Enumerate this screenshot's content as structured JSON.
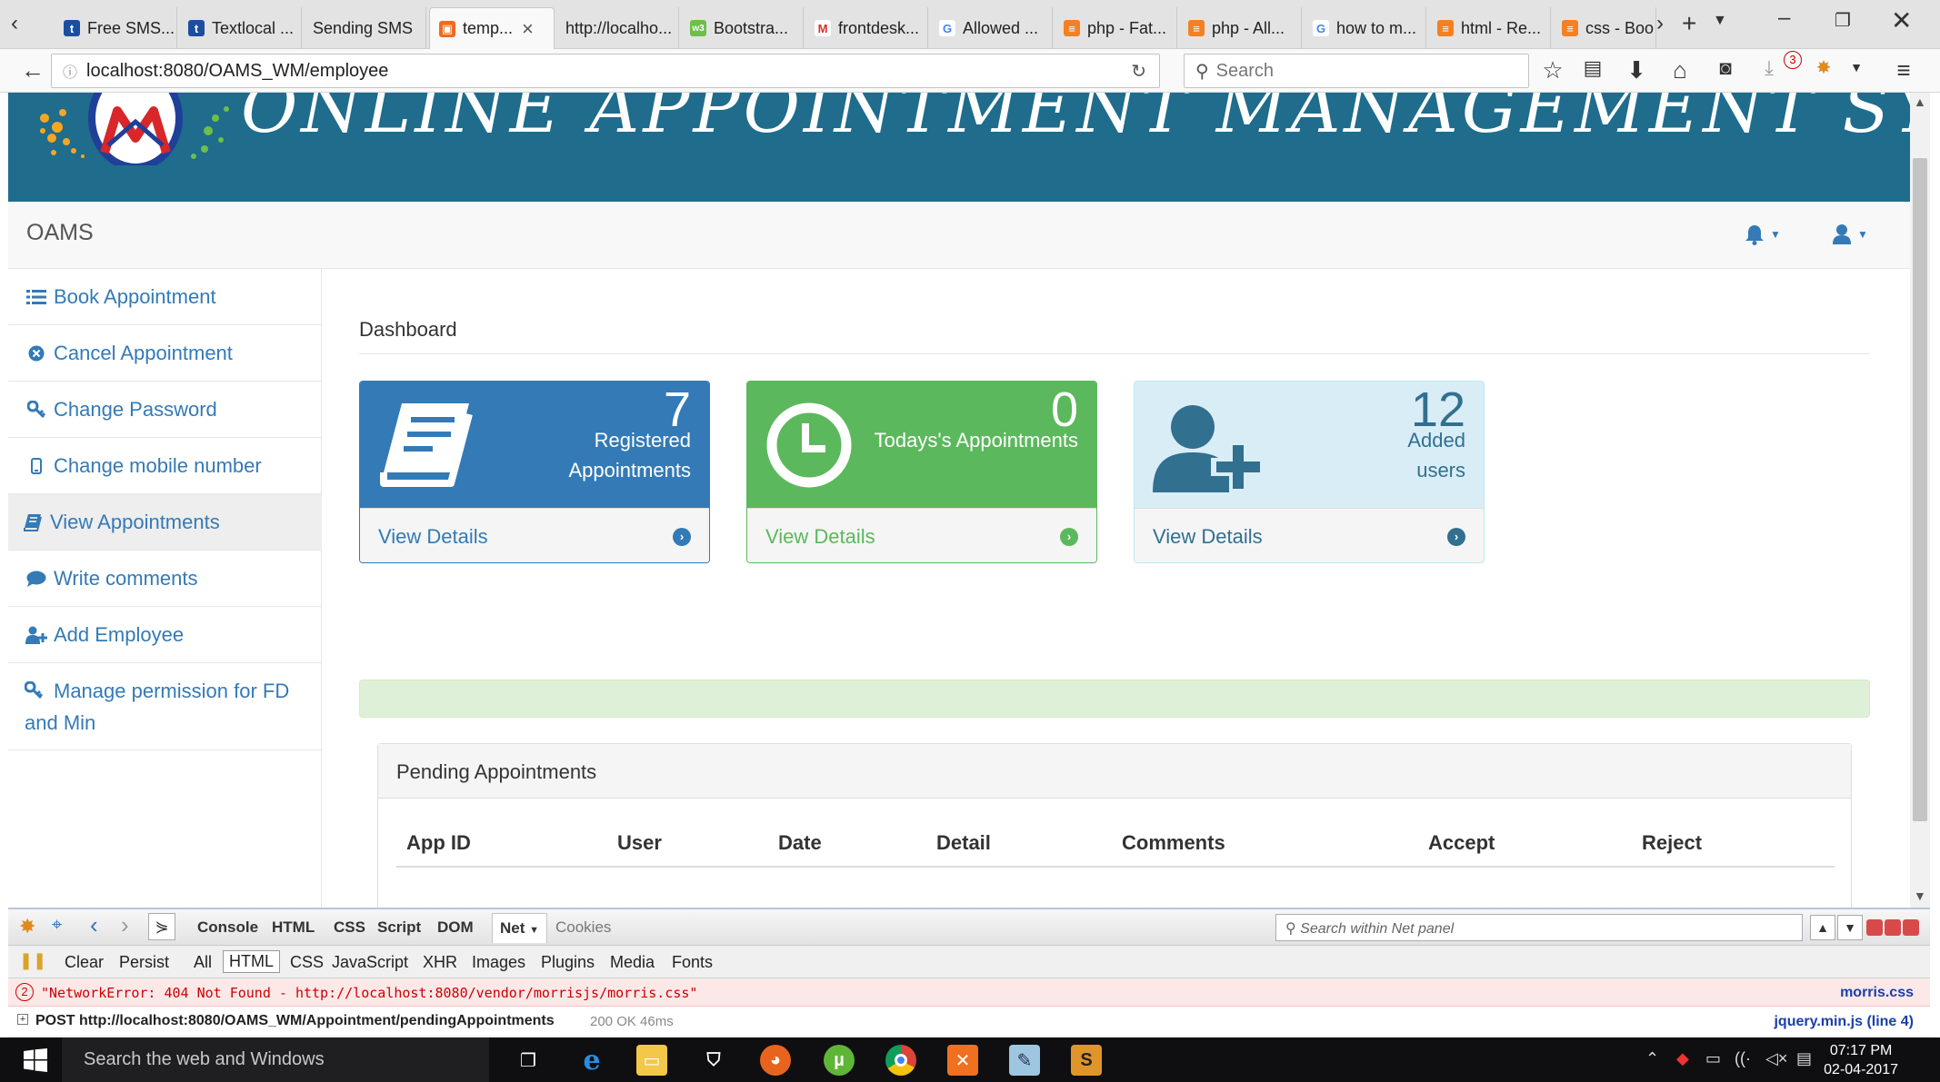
{
  "browser": {
    "tabs": [
      {
        "label": "Free SMS..."
      },
      {
        "label": "Textlocal ..."
      },
      {
        "label": "Sending SMS"
      },
      {
        "label": "temp..."
      },
      {
        "label": "http://localho..."
      },
      {
        "label": "Bootstra..."
      },
      {
        "label": "frontdesk..."
      },
      {
        "label": "Allowed ..."
      },
      {
        "label": "php - Fat..."
      },
      {
        "label": "php - All..."
      },
      {
        "label": "how to m..."
      },
      {
        "label": "html - Re..."
      },
      {
        "label": "css - Boo"
      }
    ],
    "url": "localhost:8080/OAMS_WM/employee",
    "search_placeholder": "Search",
    "download_badge": "3"
  },
  "page": {
    "banner_title": "ONLINE APPOINTMENT MANAGEMENT SYSTEM",
    "brand": "OAMS",
    "sidebar": [
      {
        "label": "Book Appointment",
        "icon": "list-icon"
      },
      {
        "label": "Cancel Appointment",
        "icon": "times-circle-icon"
      },
      {
        "label": "Change Password",
        "icon": "key-icon"
      },
      {
        "label": "Change mobile number",
        "icon": "mobile-icon"
      },
      {
        "label": "View Appointments",
        "icon": "book-icon"
      },
      {
        "label": "Write comments",
        "icon": "comment-icon"
      },
      {
        "label": "Add Employee",
        "icon": "user-plus-icon"
      },
      {
        "label": "Manage permission for FD and Min",
        "icon": "key-icon"
      }
    ],
    "dashboard_title": "Dashboard",
    "panels": [
      {
        "count": "7",
        "label": "Registered Appointments",
        "footer": "View Details",
        "color": "#337ab7"
      },
      {
        "count": "0",
        "label": "Todays's Appointments",
        "footer": "View Details",
        "color": "#5cb85c"
      },
      {
        "count": "12",
        "label": "Added users",
        "footer": "View Details",
        "color": "#d9edf7"
      }
    ],
    "pending": {
      "title": "Pending Appointments",
      "columns": [
        "App ID",
        "User",
        "Date",
        "Detail",
        "Comments",
        "Accept",
        "Reject"
      ]
    }
  },
  "firebug": {
    "tabs": [
      "Console",
      "HTML",
      "CSS",
      "Script",
      "DOM",
      "Net",
      "Cookies"
    ],
    "search_placeholder": "Search within Net panel",
    "filters": [
      "Clear",
      "Persist",
      "All",
      "HTML",
      "CSS",
      "JavaScript",
      "XHR",
      "Images",
      "Plugins",
      "Media",
      "Fonts"
    ],
    "error_count": "2",
    "error_message": "\"NetworkError: 404 Not Found - http://localhost:8080/vendor/morrisjs/morris.css\"",
    "error_source": "morris.css",
    "post_message": "POST http://localhost:8080/OAMS_WM/Appointment/pendingAppointments",
    "post_status": "200 OK 46ms",
    "post_source": "jquery.min.js (line 4)"
  },
  "taskbar": {
    "search_placeholder": "Search the web and Windows",
    "time": "07:17 PM",
    "date": "02-04-2017"
  }
}
